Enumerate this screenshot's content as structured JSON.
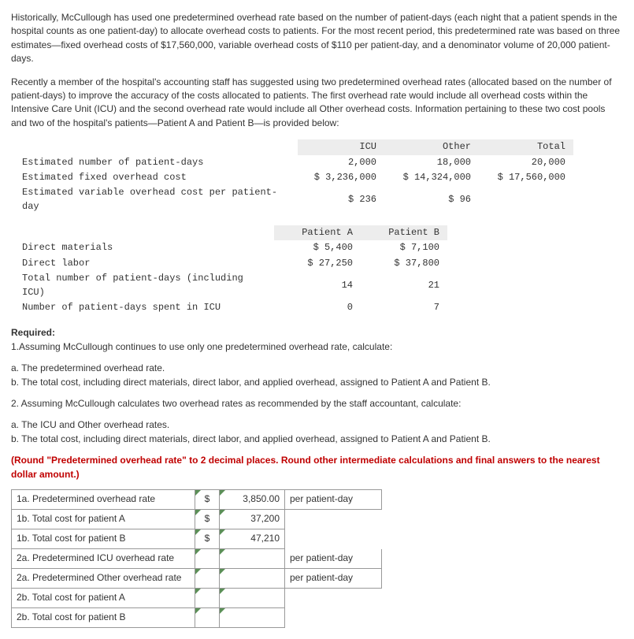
{
  "intro": {
    "p1": "Historically, McCullough has used one predetermined overhead rate based on the number of patient-days (each night that a patient spends in the hospital counts as one patient-day) to allocate overhead costs to patients. For the most recent period, this predetermined rate was based on three estimates—fixed overhead costs of $17,560,000, variable overhead costs of $110 per patient-day, and a denominator volume of 20,000 patient-days.",
    "p2": "Recently a member of the hospital's accounting staff has suggested using two predetermined overhead rates (allocated based on the number of patient-days) to improve the accuracy of the costs allocated to patients. The first overhead rate would include all overhead costs within the Intensive Care Unit (ICU) and the second overhead rate would include all Other overhead costs. Information pertaining to these two cost pools and two of the hospital's patients—Patient A and Patient B—is provided below:"
  },
  "t1": {
    "head": {
      "c1": "ICU",
      "c2": "Other",
      "c3": "Total"
    },
    "rows": [
      {
        "label": "Estimated number of patient-days",
        "icu": "2,000",
        "other": "18,000",
        "total": "20,000"
      },
      {
        "label": "Estimated fixed overhead cost",
        "icu": "$ 3,236,000",
        "other": "$ 14,324,000",
        "total": "$ 17,560,000"
      },
      {
        "label": "Estimated variable overhead cost per patient-day",
        "icu": "$ 236",
        "other": "$ 96",
        "total": ""
      }
    ]
  },
  "t2": {
    "head": {
      "c1": "Patient A",
      "c2": "Patient B"
    },
    "rows": [
      {
        "label": "Direct materials",
        "a": "$ 5,400",
        "b": "$ 7,100"
      },
      {
        "label": "Direct labor",
        "a": "$ 27,250",
        "b": "$ 37,800"
      },
      {
        "label": "Total number of patient-days (including ICU)",
        "a": "14",
        "b": "21"
      },
      {
        "label": "Number of patient-days spent in ICU",
        "a": "0",
        "b": "7"
      }
    ]
  },
  "req": {
    "title": "Required:",
    "line1": "1.Assuming McCullough continues to use only one predetermined overhead rate, calculate:",
    "a1": "a. The predetermined overhead rate.",
    "b1": "b. The total cost, including direct materials, direct labor, and applied overhead, assigned to Patient A and Patient B.",
    "line2": "2. Assuming McCullough calculates two overhead rates as recommended by the staff accountant, calculate:",
    "a2": "a. The ICU and Other overhead rates.",
    "b2": "b. The total cost, including direct materials, direct labor, and applied overhead, assigned to Patient A and Patient B.",
    "note": "(Round \"Predetermined overhead rate\" to 2 decimal places. Round other intermediate calculations and final answers to the nearest dollar amount.)"
  },
  "ans": {
    "dollar": "$",
    "unit": "per patient-day",
    "rows": [
      {
        "label": "1a. Predetermined overhead rate",
        "cur": true,
        "val": "3,850.00",
        "unit": true
      },
      {
        "label": "1b. Total cost for patient A",
        "cur": true,
        "val": "37,200",
        "unit": false
      },
      {
        "label": "1b. Total cost for patient B",
        "cur": true,
        "val": "47,210",
        "unit": false
      },
      {
        "label": "2a. Predetermined ICU overhead rate",
        "cur": false,
        "val": "",
        "unit": true
      },
      {
        "label": "2a. Predetermined Other overhead rate",
        "cur": false,
        "val": "",
        "unit": true
      },
      {
        "label": "2b. Total cost for patient A",
        "cur": false,
        "val": "",
        "unit": false
      },
      {
        "label": "2b. Total cost for patient B",
        "cur": false,
        "val": "",
        "unit": false
      }
    ]
  }
}
